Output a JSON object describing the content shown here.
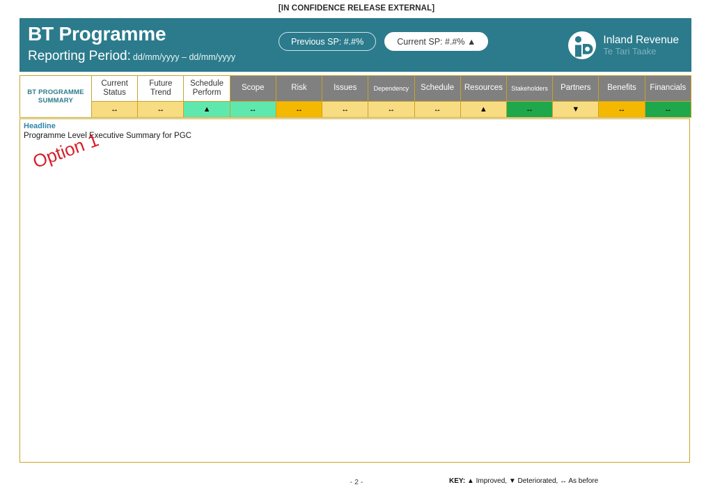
{
  "classification": "[IN CONFIDENCE RELEASE EXTERNAL]",
  "header": {
    "title": "BT Programme",
    "period_label": "Reporting Period:",
    "period_dates": "dd/mm/yyyy – dd/mm/yyyy",
    "previous_sp": "Previous SP: #.#%",
    "current_sp": "Current SP: #.#% ▲",
    "background_color": "#2b7b8c",
    "logo": {
      "name": "Inland Revenue",
      "subtitle": "Te Tari Taake"
    }
  },
  "status_table": {
    "corner_label_line1": "BT PROGRAMME",
    "corner_label_line2": "SUMMARY",
    "columns": [
      {
        "label": "Current Status",
        "label_line1": "Current",
        "label_line2": "Status",
        "header_style": "white",
        "trend": "↔",
        "cell_color": "#f7dc82"
      },
      {
        "label": "Future Trend",
        "label_line1": "Future",
        "label_line2": "Trend",
        "header_style": "white",
        "trend": "↔",
        "cell_color": "#f7dc82"
      },
      {
        "label": "Schedule Perform",
        "label_line1": "Schedule",
        "label_line2": "Perform",
        "header_style": "white",
        "trend": "▲",
        "cell_color": "#5fe8ad"
      },
      {
        "label": "Scope",
        "label_line1": "Scope",
        "label_line2": "",
        "header_style": "gray",
        "trend": "↔",
        "cell_color": "#5fe8ad"
      },
      {
        "label": "Risk",
        "label_line1": "Risk",
        "label_line2": "",
        "header_style": "gray",
        "trend": "↔",
        "cell_color": "#f5b800"
      },
      {
        "label": "Issues",
        "label_line1": "Issues",
        "label_line2": "",
        "header_style": "gray",
        "trend": "↔",
        "cell_color": "#f7dc82"
      },
      {
        "label": "Dependency",
        "label_line1": "Dependency",
        "label_line2": "",
        "header_style": "gray-small",
        "trend": "↔",
        "cell_color": "#f7dc82"
      },
      {
        "label": "Schedule",
        "label_line1": "Schedule",
        "label_line2": "",
        "header_style": "gray",
        "trend": "↔",
        "cell_color": "#f7dc82"
      },
      {
        "label": "Resources",
        "label_line1": "Resources",
        "label_line2": "",
        "header_style": "gray",
        "trend": "▲",
        "cell_color": "#f7dc82"
      },
      {
        "label": "Stakeholders",
        "label_line1": "Stakeholders",
        "label_line2": "",
        "header_style": "gray-small",
        "trend": "↔",
        "cell_color": "#1fa84b"
      },
      {
        "label": "Partners",
        "label_line1": "Partners",
        "label_line2": "",
        "header_style": "gray",
        "trend": "▼",
        "cell_color": "#f7dc82"
      },
      {
        "label": "Benefits",
        "label_line1": "Benefits",
        "label_line2": "",
        "header_style": "gray",
        "trend": "↔",
        "cell_color": "#f5b800"
      },
      {
        "label": "Financials",
        "label_line1": "Financials",
        "label_line2": "",
        "header_style": "gray",
        "trend": "↔",
        "cell_color": "#1fa84b"
      }
    ]
  },
  "body": {
    "headline_label": "Headline",
    "headline_text": "Programme Level Executive Summary for PGC",
    "option_stamp": "Option 1",
    "option_stamp_color": "#d6202a"
  },
  "footer": {
    "page_number": "- 2 -",
    "key_word": "KEY:",
    "key_text": " ▲ Improved, ▼ Deteriorated, ↔  As before"
  }
}
